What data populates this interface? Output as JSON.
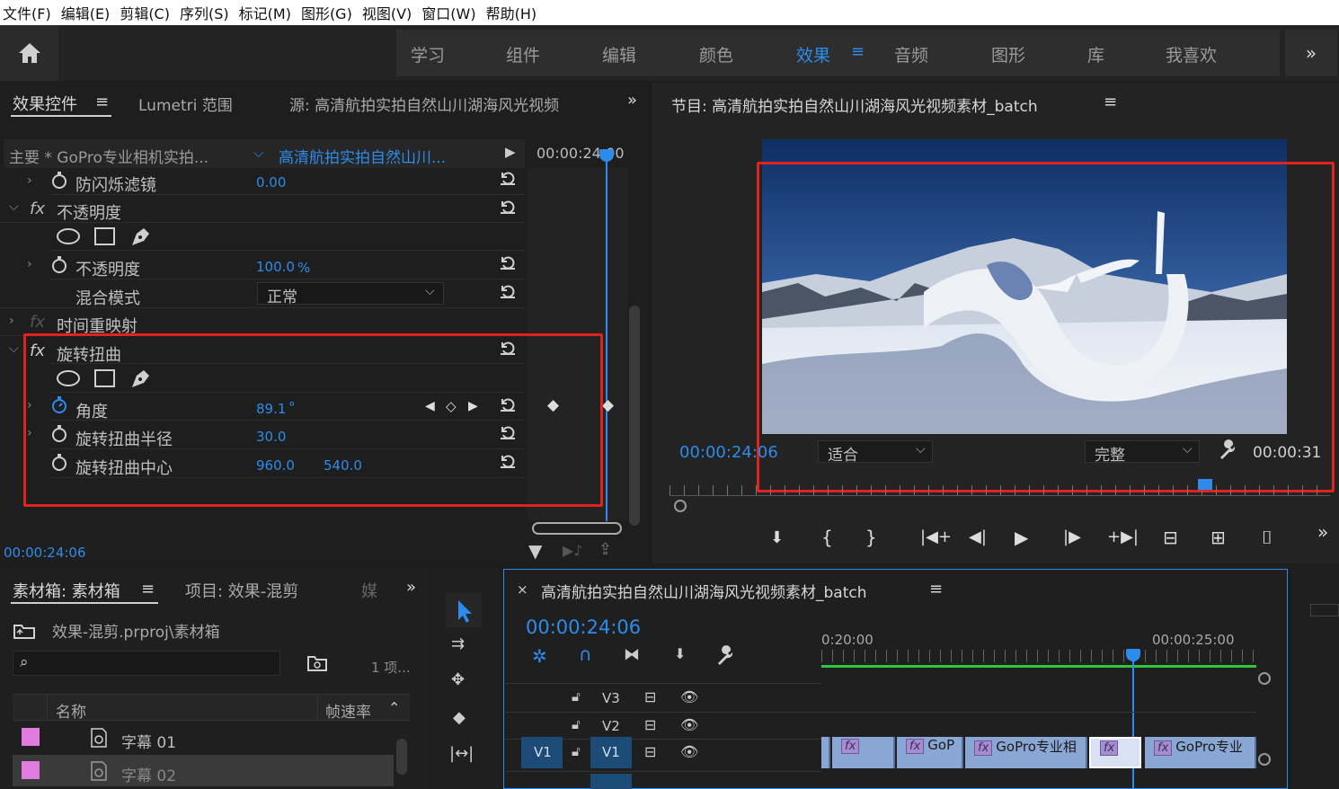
{
  "menu": [
    "文件(F)",
    "编辑(E)",
    "剪辑(C)",
    "序列(S)",
    "标记(M)",
    "图形(G)",
    "视图(V)",
    "窗口(W)",
    "帮助(H)"
  ],
  "workspaces": [
    "学习",
    "组件",
    "编辑",
    "颜色",
    "效果",
    "音频",
    "图形",
    "库",
    "我喜欢"
  ],
  "workspace_active": "效果",
  "effect_controls": {
    "tabs": [
      "效果控件",
      "Lumetri 范围",
      "源: 高清航拍实拍自然山川湖海风光视频"
    ],
    "master_label": "主要 * GoPro专业相机实拍...",
    "clip_label": "高清航拍实拍自然山川...",
    "header_timecode": "00:00:24:00",
    "rows": {
      "flicker": {
        "label": "防闪烁滤镜",
        "value": "0.00"
      },
      "opacity_group": "不透明度",
      "opacity": {
        "label": "不透明度",
        "value": "100.0",
        "unit": "%"
      },
      "blend": {
        "label": "混合模式",
        "value": "正常"
      },
      "time_remap": "时间重映射",
      "twirl_group": "旋转扭曲",
      "angle": {
        "label": "角度",
        "value": "89.1",
        "unit": "°"
      },
      "radius": {
        "label": "旋转扭曲半径",
        "value": "30.0"
      },
      "center": {
        "label": "旋转扭曲中心",
        "x": "960.0",
        "y": "540.0"
      }
    },
    "footer_timecode": "00:00:24:06"
  },
  "program": {
    "title": "节目: 高清航拍实拍自然山川湖海风光视频素材_batch",
    "timecode": "00:00:24:06",
    "fit": "适合",
    "quality": "完整",
    "duration": "00:00:31"
  },
  "bin": {
    "tabs": [
      "素材箱: 素材箱",
      "项目: 效果-混剪",
      "媒"
    ],
    "path": "效果-混剪.prproj\\素材箱",
    "count": "1 项...",
    "columns": [
      "名称",
      "帧速率"
    ],
    "items": [
      "字幕 01",
      "字幕 02"
    ],
    "search_placeholder": ""
  },
  "timeline": {
    "title": "高清航拍实拍自然山川湖海风光视频素材_batch",
    "timecode": "00:00:24:06",
    "ruler": [
      "0:20:00",
      "00:00:25:00"
    ],
    "tracks": [
      "V3",
      "V2",
      "V1"
    ],
    "source_patch": "V1",
    "clips": [
      "",
      "GoP",
      "GoPro专业相",
      "",
      "GoPro专业"
    ]
  },
  "colors": {
    "accent": "#2d8ceb",
    "highlight_box": "#e3211f",
    "label_pink": "#e07ce0",
    "clip_blue": "#8aa7d4"
  }
}
